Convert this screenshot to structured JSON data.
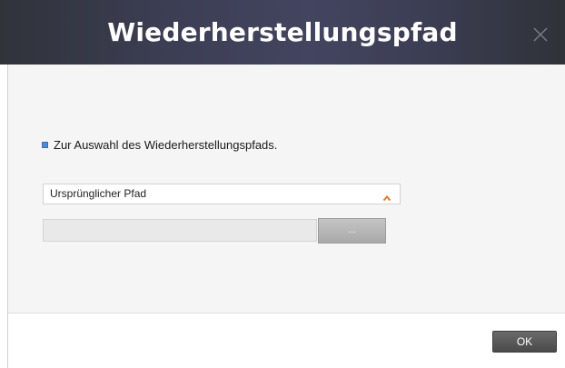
{
  "dialog": {
    "title": "Wiederherstellungspfad",
    "close_icon": "close-icon"
  },
  "content": {
    "instruction": "Zur Auswahl des Wiederherstellungspfads.",
    "path_select": {
      "selected": "Ursprünglicher Pfad",
      "icon": "chevron-up-icon"
    },
    "path_input": {
      "value": "",
      "placeholder": ""
    },
    "browse_label": "..."
  },
  "footer": {
    "ok_label": "OK"
  },
  "colors": {
    "titlebar": "#3c3e54",
    "accent": "#e8782a",
    "bullet": "#4a8ad8"
  }
}
